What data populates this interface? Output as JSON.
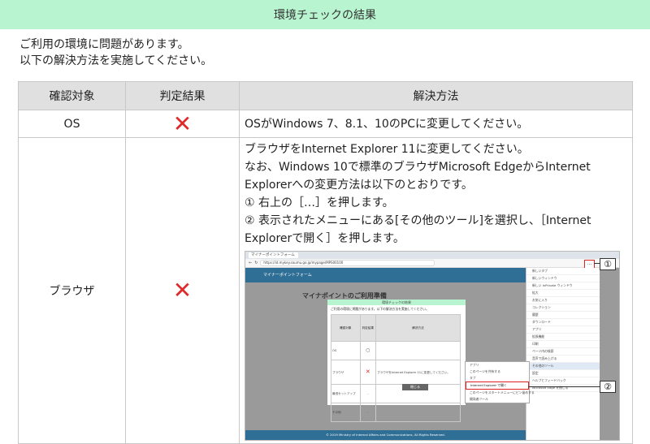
{
  "header": {
    "title": "環境チェックの結果"
  },
  "intro": {
    "line1": "ご利用の環境に問題があります。",
    "line2": "以下の解決方法を実施してください。"
  },
  "table": {
    "headers": [
      "確認対象",
      "判定結果",
      "解決方法"
    ],
    "rows": [
      {
        "target": "OS",
        "result": "fail",
        "solution": "OSがWindows 7、8.1、10のPCに変更してください。"
      },
      {
        "target": "ブラウザ",
        "result": "fail",
        "solution_lines": [
          "ブラウザをInternet Explorer 11に変更してください。",
          "なお、Windows 10で標準のブラウザMicrosoft EdgeからInternet",
          "Explorerへの変更方法は以下のとおりです。",
          "① 右上の［…］を押します。",
          "② 表示されたメニューにある[その他のツール]を選択し、［Internet",
          "Explorerで開く］を押します。"
        ]
      }
    ]
  },
  "screenshot": {
    "tab_label": "マイナーポイントフォーム",
    "url": "https://id.mykey.soumu.go.jp/mypage/MPS00100",
    "site_title": "マイナーポイントフォーム",
    "page_heading": "マイナポイントのご利用準備",
    "dialog_title": "環境チェックの結果",
    "dialog_intro": "ご利用の環境に問題があります。以下の解決方法を実施してください。",
    "dialog_headers": [
      "確認対象",
      "判定結果",
      "解決方法"
    ],
    "dialog_rows": [
      {
        "target": "OS",
        "result": "O",
        "solution": ""
      },
      {
        "target": "ブラウザ",
        "result": "X",
        "solution": "ブラウザをInternet Explorer 11に変更してください。"
      },
      {
        "target": "最低セットアップ",
        "result": "-",
        "solution": ""
      },
      {
        "target": "その他",
        "result": "-",
        "solution": ""
      }
    ],
    "close_label": "閉じる",
    "footer": "© 2019 Ministry of Internal Affairs and Communications, All Rights Reserved.",
    "menu_items": [
      "新しいタブ",
      "新しいウィンドウ",
      "新しい InPrivate ウィンドウ",
      "拡大",
      "お気に入り",
      "コレクション",
      "履歴",
      "ダウンロード",
      "アプリ",
      "拡張機能",
      "印刷",
      "ページ内の検索",
      "音声で読み上げる",
      "その他のツール",
      "設定",
      "ヘルプとフィードバック",
      "Microsoft Edge を閉じる"
    ],
    "submenu_items": [
      "アプリ",
      "このページを共有する",
      "タブ",
      "Internet Explorer で開く",
      "このページをスタートメニューにピン留めする",
      "開発者ツール"
    ],
    "dots": "…",
    "marker1": "①",
    "marker2": "②"
  },
  "colors": {
    "header_bg": "#b7f4cf",
    "cross": "#e02a2a",
    "site_blue": "#2f6e95"
  }
}
